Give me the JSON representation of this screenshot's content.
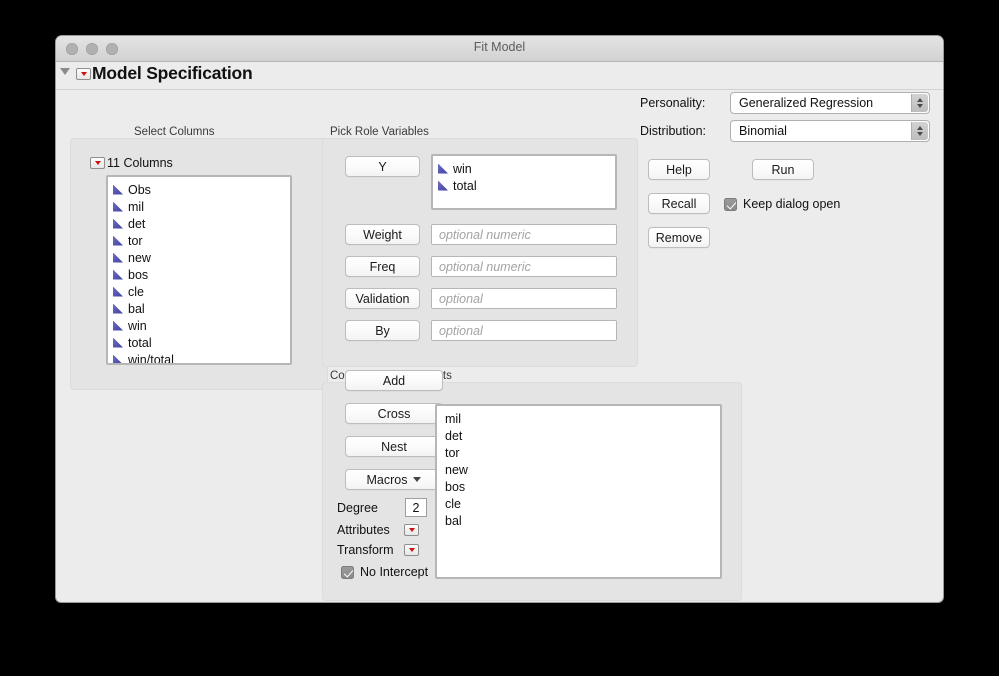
{
  "window": {
    "title": "Fit Model",
    "traffic_lights": [
      "close-button",
      "minimize-button",
      "zoom-button"
    ]
  },
  "outliner": {
    "heading": "Model Specification",
    "disclosure_icon": "disclosure-triangle-icon",
    "menu_icon": "red-popup-menu-icon"
  },
  "select_columns": {
    "group_label": "Select Columns",
    "count_label": "11 Columns",
    "menu_icon": "red-popup-menu-icon",
    "columns": [
      {
        "name": "Obs",
        "icon": "continuous-variable-icon"
      },
      {
        "name": "mil",
        "icon": "continuous-variable-icon"
      },
      {
        "name": "det",
        "icon": "continuous-variable-icon"
      },
      {
        "name": "tor",
        "icon": "continuous-variable-icon"
      },
      {
        "name": "new",
        "icon": "continuous-variable-icon"
      },
      {
        "name": "bos",
        "icon": "continuous-variable-icon"
      },
      {
        "name": "cle",
        "icon": "continuous-variable-icon"
      },
      {
        "name": "bal",
        "icon": "continuous-variable-icon"
      },
      {
        "name": "win",
        "icon": "continuous-variable-icon"
      },
      {
        "name": "total",
        "icon": "continuous-variable-icon"
      },
      {
        "name": "win/total",
        "icon": "continuous-variable-icon"
      }
    ]
  },
  "pick_role_variables": {
    "group_label": "Pick Role Variables",
    "roles": [
      {
        "button": "Y",
        "values": [
          "win",
          "total"
        ],
        "placeholder": ""
      },
      {
        "button": "Weight",
        "values": [],
        "placeholder": "optional numeric"
      },
      {
        "button": "Freq",
        "values": [],
        "placeholder": "optional numeric"
      },
      {
        "button": "Validation",
        "values": [],
        "placeholder": "optional"
      },
      {
        "button": "By",
        "values": [],
        "placeholder": "optional"
      }
    ]
  },
  "construct_model_effects": {
    "group_label": "Construct Model Effects",
    "buttons": [
      "Add",
      "Cross",
      "Nest"
    ],
    "macros_label": "Macros",
    "degree_label": "Degree",
    "degree_value": "2",
    "attributes_label": "Attributes",
    "transform_label": "Transform",
    "no_intercept_label": "No Intercept",
    "no_intercept_checked": true,
    "effects": [
      "mil",
      "det",
      "tor",
      "new",
      "bos",
      "cle",
      "bal"
    ]
  },
  "right_panel": {
    "personality_label": "Personality:",
    "personality_value": "Generalized Regression",
    "distribution_label": "Distribution:",
    "distribution_value": "Binomial",
    "help_label": "Help",
    "run_label": "Run",
    "recall_label": "Recall",
    "remove_label": "Remove",
    "keep_dialog_open_label": "Keep dialog open",
    "keep_dialog_open_checked": true
  },
  "colors": {
    "window_bg": "#ececec",
    "group_bg": "#e4e4e4",
    "variable_icon": "#4040a0",
    "popup_red": "#cc1111",
    "desktop": "#000000"
  }
}
